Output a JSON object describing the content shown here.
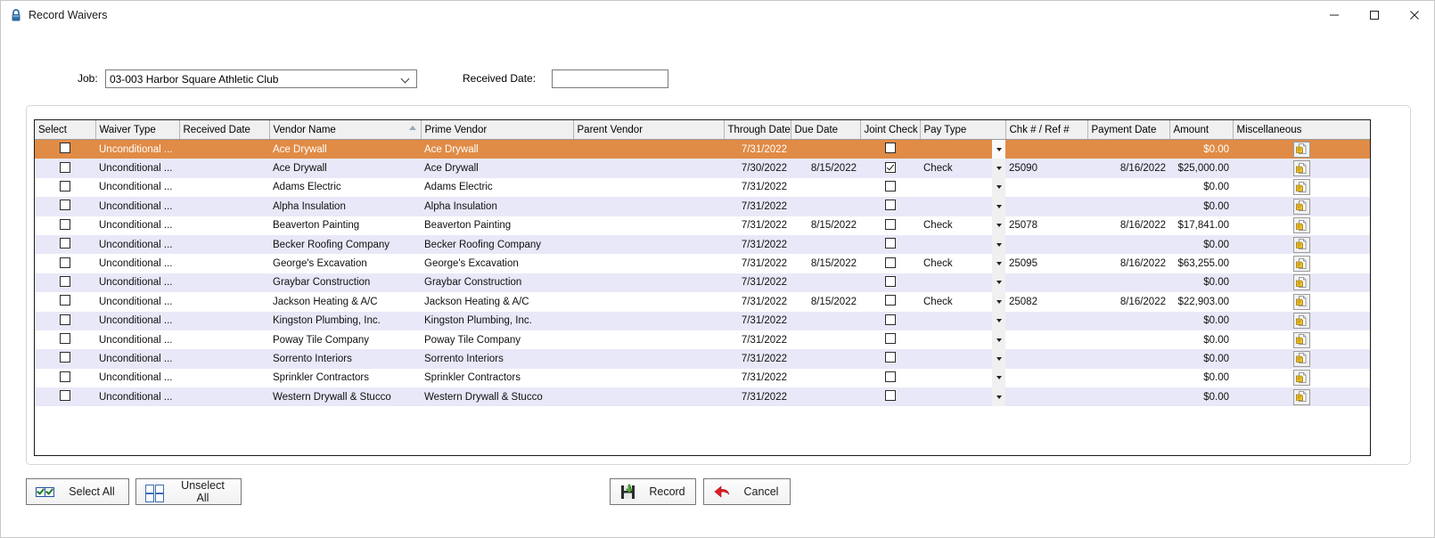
{
  "window": {
    "title": "Record Waivers",
    "lock_icon": "lock-icon",
    "controls": {
      "minimize": "—",
      "maximize": "☐",
      "close": "✕"
    }
  },
  "form": {
    "job_label": "Job:",
    "job_value": "03-003  Harbor Square Athletic Club",
    "received_date_label": "Received Date:",
    "received_date_value": "",
    "received_date_placeholder": ""
  },
  "grid": {
    "columns": [
      "Select",
      "Waiver Type",
      "Received Date",
      "Vendor Name",
      "Prime Vendor",
      "Parent Vendor",
      "Through Date",
      "Due Date",
      "Joint Check",
      "Pay Type",
      "Chk # / Ref #",
      "Payment Date",
      "Amount",
      "Miscellaneous"
    ],
    "sort_column": "Vendor Name",
    "sort_direction": "asc",
    "rows": [
      {
        "selected": true,
        "select_checked": false,
        "waiver_type": "Unconditional ...",
        "received_date": "",
        "vendor_name": "Ace Drywall",
        "prime_vendor": "Ace Drywall",
        "parent_vendor": "",
        "through_date": "7/31/2022",
        "due_date": "",
        "joint_check": false,
        "pay_type": "",
        "chk_ref": "",
        "payment_date": "",
        "amount": "$0.00",
        "misc_icon": "document-note-icon"
      },
      {
        "selected": false,
        "select_checked": false,
        "waiver_type": "Unconditional ...",
        "received_date": "",
        "vendor_name": "Ace Drywall",
        "prime_vendor": "Ace Drywall",
        "parent_vendor": "",
        "through_date": "7/30/2022",
        "due_date": "8/15/2022",
        "joint_check": true,
        "pay_type": "Check",
        "chk_ref": "25090",
        "payment_date": "8/16/2022",
        "amount": "$25,000.00",
        "misc_icon": "document-note-icon"
      },
      {
        "selected": false,
        "select_checked": false,
        "waiver_type": "Unconditional ...",
        "received_date": "",
        "vendor_name": "Adams Electric",
        "prime_vendor": "Adams Electric",
        "parent_vendor": "",
        "through_date": "7/31/2022",
        "due_date": "",
        "joint_check": false,
        "pay_type": "",
        "chk_ref": "",
        "payment_date": "",
        "amount": "$0.00",
        "misc_icon": "document-note-icon"
      },
      {
        "selected": false,
        "select_checked": false,
        "waiver_type": "Unconditional ...",
        "received_date": "",
        "vendor_name": "Alpha Insulation",
        "prime_vendor": "Alpha Insulation",
        "parent_vendor": "",
        "through_date": "7/31/2022",
        "due_date": "",
        "joint_check": false,
        "pay_type": "",
        "chk_ref": "",
        "payment_date": "",
        "amount": "$0.00",
        "misc_icon": "document-note-icon"
      },
      {
        "selected": false,
        "select_checked": false,
        "waiver_type": "Unconditional ...",
        "received_date": "",
        "vendor_name": "Beaverton Painting",
        "prime_vendor": "Beaverton Painting",
        "parent_vendor": "",
        "through_date": "7/31/2022",
        "due_date": "8/15/2022",
        "joint_check": false,
        "pay_type": "Check",
        "chk_ref": "25078",
        "payment_date": "8/16/2022",
        "amount": "$17,841.00",
        "misc_icon": "document-note-icon"
      },
      {
        "selected": false,
        "select_checked": false,
        "waiver_type": "Unconditional ...",
        "received_date": "",
        "vendor_name": "Becker Roofing Company",
        "prime_vendor": "Becker Roofing Company",
        "parent_vendor": "",
        "through_date": "7/31/2022",
        "due_date": "",
        "joint_check": false,
        "pay_type": "",
        "chk_ref": "",
        "payment_date": "",
        "amount": "$0.00",
        "misc_icon": "document-note-icon"
      },
      {
        "selected": false,
        "select_checked": false,
        "waiver_type": "Unconditional ...",
        "received_date": "",
        "vendor_name": "George's Excavation",
        "prime_vendor": "George's Excavation",
        "parent_vendor": "",
        "through_date": "7/31/2022",
        "due_date": "8/15/2022",
        "joint_check": false,
        "pay_type": "Check",
        "chk_ref": "25095",
        "payment_date": "8/16/2022",
        "amount": "$63,255.00",
        "misc_icon": "document-note-icon"
      },
      {
        "selected": false,
        "select_checked": false,
        "waiver_type": "Unconditional ...",
        "received_date": "",
        "vendor_name": "Graybar Construction",
        "prime_vendor": "Graybar Construction",
        "parent_vendor": "",
        "through_date": "7/31/2022",
        "due_date": "",
        "joint_check": false,
        "pay_type": "",
        "chk_ref": "",
        "payment_date": "",
        "amount": "$0.00",
        "misc_icon": "document-note-icon"
      },
      {
        "selected": false,
        "select_checked": false,
        "waiver_type": "Unconditional ...",
        "received_date": "",
        "vendor_name": "Jackson Heating & A/C",
        "prime_vendor": "Jackson Heating & A/C",
        "parent_vendor": "",
        "through_date": "7/31/2022",
        "due_date": "8/15/2022",
        "joint_check": false,
        "pay_type": "Check",
        "chk_ref": "25082",
        "payment_date": "8/16/2022",
        "amount": "$22,903.00",
        "misc_icon": "document-note-icon"
      },
      {
        "selected": false,
        "select_checked": false,
        "waiver_type": "Unconditional ...",
        "received_date": "",
        "vendor_name": "Kingston Plumbing, Inc.",
        "prime_vendor": "Kingston Plumbing, Inc.",
        "parent_vendor": "",
        "through_date": "7/31/2022",
        "due_date": "",
        "joint_check": false,
        "pay_type": "",
        "chk_ref": "",
        "payment_date": "",
        "amount": "$0.00",
        "misc_icon": "document-note-icon"
      },
      {
        "selected": false,
        "select_checked": false,
        "waiver_type": "Unconditional ...",
        "received_date": "",
        "vendor_name": "Poway Tile Company",
        "prime_vendor": "Poway Tile Company",
        "parent_vendor": "",
        "through_date": "7/31/2022",
        "due_date": "",
        "joint_check": false,
        "pay_type": "",
        "chk_ref": "",
        "payment_date": "",
        "amount": "$0.00",
        "misc_icon": "document-note-icon"
      },
      {
        "selected": false,
        "select_checked": false,
        "waiver_type": "Unconditional ...",
        "received_date": "",
        "vendor_name": "Sorrento Interiors",
        "prime_vendor": "Sorrento Interiors",
        "parent_vendor": "",
        "through_date": "7/31/2022",
        "due_date": "",
        "joint_check": false,
        "pay_type": "",
        "chk_ref": "",
        "payment_date": "",
        "amount": "$0.00",
        "misc_icon": "document-note-icon"
      },
      {
        "selected": false,
        "select_checked": false,
        "waiver_type": "Unconditional ...",
        "received_date": "",
        "vendor_name": "Sprinkler Contractors",
        "prime_vendor": "Sprinkler Contractors",
        "parent_vendor": "",
        "through_date": "7/31/2022",
        "due_date": "",
        "joint_check": false,
        "pay_type": "",
        "chk_ref": "",
        "payment_date": "",
        "amount": "$0.00",
        "misc_icon": "document-note-icon"
      },
      {
        "selected": false,
        "select_checked": false,
        "waiver_type": "Unconditional ...",
        "received_date": "",
        "vendor_name": "Western Drywall & Stucco",
        "prime_vendor": "Western Drywall & Stucco",
        "parent_vendor": "",
        "through_date": "7/31/2022",
        "due_date": "",
        "joint_check": false,
        "pay_type": "",
        "chk_ref": "",
        "payment_date": "",
        "amount": "$0.00",
        "misc_icon": "document-note-icon"
      }
    ]
  },
  "buttons": {
    "select_all": "Select All",
    "unselect_all": "Unselect All",
    "record": "Record",
    "cancel": "Cancel"
  },
  "colors": {
    "selected_row": "#e08b46",
    "alt_row": "#e8e8f8",
    "header": "#f0f0f0",
    "accent": "#2452a0"
  }
}
